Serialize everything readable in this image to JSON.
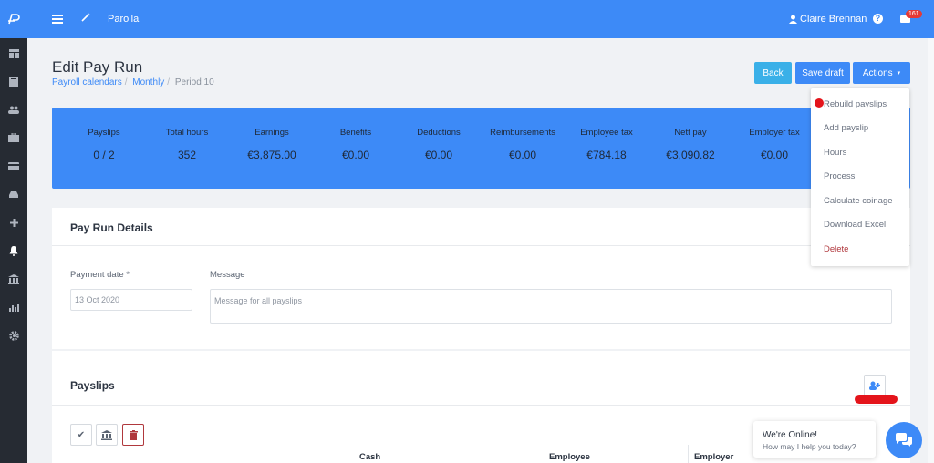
{
  "app": {
    "title": "Parolla"
  },
  "topbar": {
    "user_name": "Claire Brennan",
    "mail_count": "161"
  },
  "page": {
    "title": "Edit Pay Run",
    "breadcrumb": [
      "Payroll calendars",
      "Monthly",
      "Period 10"
    ]
  },
  "buttons": {
    "back": "Back",
    "save": "Save draft",
    "actions": "Actions"
  },
  "summary": [
    {
      "label": "Payslips",
      "value": "0 / 2"
    },
    {
      "label": "Total hours",
      "value": "352"
    },
    {
      "label": "Earnings",
      "value": "€3,875.00"
    },
    {
      "label": "Benefits",
      "value": "€0.00"
    },
    {
      "label": "Deductions",
      "value": "€0.00"
    },
    {
      "label": "Reimbursements",
      "value": "€0.00"
    },
    {
      "label": "Employee tax",
      "value": "€784.18"
    },
    {
      "label": "Nett pay",
      "value": "€3,090.82"
    },
    {
      "label": "Employer tax",
      "value": "€0.00"
    }
  ],
  "details": {
    "heading": "Pay Run Details",
    "payment_label": "Payment date *",
    "payment_value": "13 Oct 2020",
    "message_label": "Message",
    "message_placeholder": "Message for all payslips"
  },
  "payslips": {
    "heading": "Payslips",
    "columns": [
      "Cash",
      "Employee",
      "Employer"
    ]
  },
  "actions_menu": [
    "Rebuild payslips",
    "Add payslip",
    "Hours",
    "Process",
    "Calculate coinage",
    "Download Excel",
    "Delete"
  ],
  "chat": {
    "title": "We're Online!",
    "subtitle": "How may I help you today?"
  },
  "colors": {
    "primary": "#3d8af7",
    "sidebar": "#262b33",
    "accent_red": "#e4141b"
  }
}
